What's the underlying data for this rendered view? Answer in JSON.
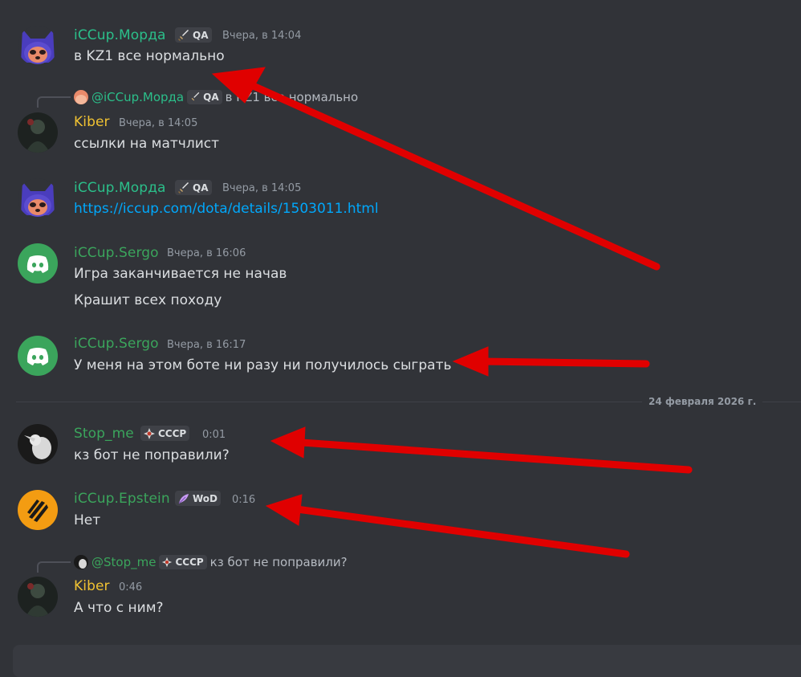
{
  "colors": {
    "background": "#313338",
    "name_green": "#3ba55c",
    "name_teal": "#2bbf8a",
    "name_yellow": "#f0c232",
    "link": "#00a8fc",
    "arrow": "#e00000"
  },
  "messages": [
    {
      "author": "iCCup.Морда",
      "tag": "QA",
      "tag_icon": "sword-icon",
      "time": "Вчера, в 14:04",
      "text": "в KZ1  все нормально"
    },
    {
      "reply_to": {
        "author": "@iCCup.Морда",
        "tag": "QA",
        "text": "в KZ1 все нормально"
      },
      "author": "Kiber",
      "time": "Вчера, в 14:05",
      "text": "ссылки на матчлист"
    },
    {
      "author": "iCCup.Морда",
      "tag": "QA",
      "tag_icon": "sword-icon",
      "time": "Вчера, в 14:05",
      "text": "https://iccup.com/dota/details/1503011.html"
    },
    {
      "author": "iCCup.Sergo",
      "time": "Вчера, в 16:06",
      "text": "Игра заканчивается не начав",
      "text2": "Крашит всех походу"
    },
    {
      "author": "iCCup.Sergo",
      "time": "Вчера, в 16:17",
      "text": "У меня на этом боте ни разу ни получилось сыграть"
    },
    {
      "author": "Stop_me",
      "tag": "СССР",
      "tag_icon": "star-emblem-icon",
      "time": "0:01",
      "text": "кз бот не поправили?"
    },
    {
      "author": "iCCup.Epstein",
      "tag": "WoD",
      "tag_icon": "feather-icon",
      "time": "0:16",
      "text": "Нет"
    },
    {
      "reply_to": {
        "author": "@Stop_me",
        "tag": "СССР",
        "text": "кз бот не поправили?"
      },
      "author": "Kiber",
      "time": "0:46",
      "text": "А что с ним?"
    }
  ],
  "date_divider": "24 февраля 2026 г."
}
